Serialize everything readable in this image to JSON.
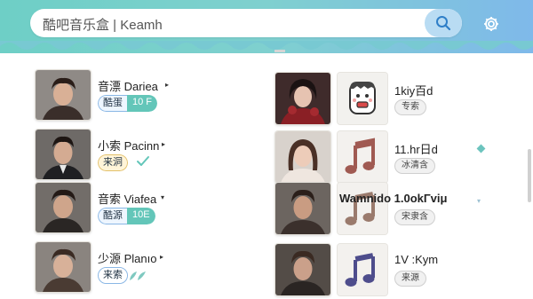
{
  "header": {
    "search_text": "酷吧音乐盒 | Keamh",
    "search_icon": "search-icon",
    "settings_icon": "gear-icon"
  },
  "left_list": [
    {
      "name": "音漂 Dariea",
      "badge_primary": "酷蛋",
      "badge_secondary": "10 F",
      "badge_style": "teal"
    },
    {
      "name": "小索 Pacinn",
      "badge_primary": "来洞",
      "badge_secondary": "",
      "badge_style": "gold",
      "extra_icon": "check-icon"
    },
    {
      "name": "音索 Viafea",
      "badge_primary": "酷源",
      "badge_secondary": "10E",
      "badge_style": "teal"
    },
    {
      "name": "少源 Planıo",
      "badge_primary": "来索",
      "badge_secondary": "",
      "badge_style": "outline",
      "extra_icon": "leaf-icon"
    }
  ],
  "right_list": [
    {
      "title": "1kiy百d",
      "tag": "专索",
      "thumb_icon": "cartoon-face-icon"
    },
    {
      "title": "11.hr日d",
      "tag": "冰清含",
      "thumb_icon": "music-note-icon"
    },
    {
      "title": "Wamnido  1.0okΓviμ",
      "tag": "宋隶含",
      "thumb_icon": "music-note-icon"
    },
    {
      "title": "1V :Kym",
      "tag": "来源",
      "thumb_icon": "music-note-icon"
    }
  ],
  "colors": {
    "header_start": "#6ecfc6",
    "header_end": "#7fb9ea",
    "accent_teal": "#63c6b9",
    "note_red": "#a05a52",
    "note_brown": "#9a7a6c",
    "note_purple": "#4e4d8c"
  }
}
